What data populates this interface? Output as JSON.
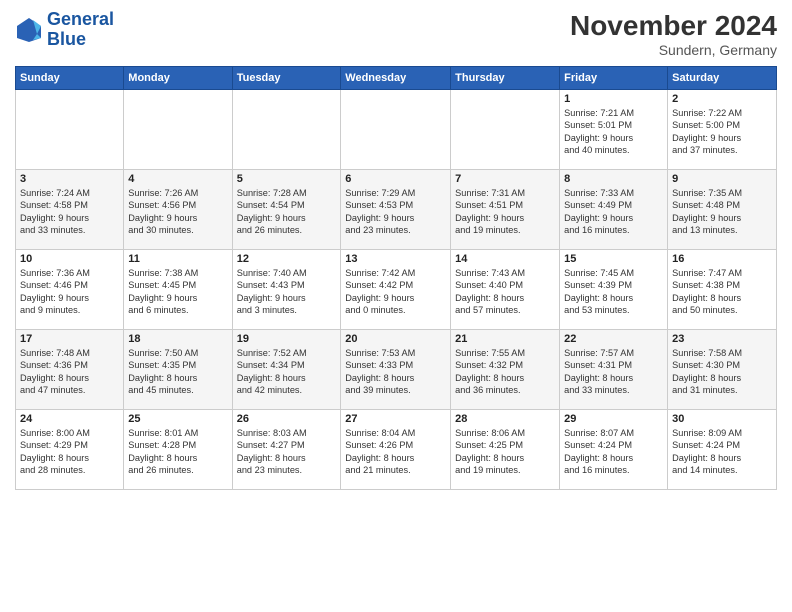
{
  "header": {
    "logo_line1": "General",
    "logo_line2": "Blue",
    "month_title": "November 2024",
    "subtitle": "Sundern, Germany"
  },
  "weekdays": [
    "Sunday",
    "Monday",
    "Tuesday",
    "Wednesday",
    "Thursday",
    "Friday",
    "Saturday"
  ],
  "weeks": [
    [
      {
        "day": "",
        "info": ""
      },
      {
        "day": "",
        "info": ""
      },
      {
        "day": "",
        "info": ""
      },
      {
        "day": "",
        "info": ""
      },
      {
        "day": "",
        "info": ""
      },
      {
        "day": "1",
        "info": "Sunrise: 7:21 AM\nSunset: 5:01 PM\nDaylight: 9 hours\nand 40 minutes."
      },
      {
        "day": "2",
        "info": "Sunrise: 7:22 AM\nSunset: 5:00 PM\nDaylight: 9 hours\nand 37 minutes."
      }
    ],
    [
      {
        "day": "3",
        "info": "Sunrise: 7:24 AM\nSunset: 4:58 PM\nDaylight: 9 hours\nand 33 minutes."
      },
      {
        "day": "4",
        "info": "Sunrise: 7:26 AM\nSunset: 4:56 PM\nDaylight: 9 hours\nand 30 minutes."
      },
      {
        "day": "5",
        "info": "Sunrise: 7:28 AM\nSunset: 4:54 PM\nDaylight: 9 hours\nand 26 minutes."
      },
      {
        "day": "6",
        "info": "Sunrise: 7:29 AM\nSunset: 4:53 PM\nDaylight: 9 hours\nand 23 minutes."
      },
      {
        "day": "7",
        "info": "Sunrise: 7:31 AM\nSunset: 4:51 PM\nDaylight: 9 hours\nand 19 minutes."
      },
      {
        "day": "8",
        "info": "Sunrise: 7:33 AM\nSunset: 4:49 PM\nDaylight: 9 hours\nand 16 minutes."
      },
      {
        "day": "9",
        "info": "Sunrise: 7:35 AM\nSunset: 4:48 PM\nDaylight: 9 hours\nand 13 minutes."
      }
    ],
    [
      {
        "day": "10",
        "info": "Sunrise: 7:36 AM\nSunset: 4:46 PM\nDaylight: 9 hours\nand 9 minutes."
      },
      {
        "day": "11",
        "info": "Sunrise: 7:38 AM\nSunset: 4:45 PM\nDaylight: 9 hours\nand 6 minutes."
      },
      {
        "day": "12",
        "info": "Sunrise: 7:40 AM\nSunset: 4:43 PM\nDaylight: 9 hours\nand 3 minutes."
      },
      {
        "day": "13",
        "info": "Sunrise: 7:42 AM\nSunset: 4:42 PM\nDaylight: 9 hours\nand 0 minutes."
      },
      {
        "day": "14",
        "info": "Sunrise: 7:43 AM\nSunset: 4:40 PM\nDaylight: 8 hours\nand 57 minutes."
      },
      {
        "day": "15",
        "info": "Sunrise: 7:45 AM\nSunset: 4:39 PM\nDaylight: 8 hours\nand 53 minutes."
      },
      {
        "day": "16",
        "info": "Sunrise: 7:47 AM\nSunset: 4:38 PM\nDaylight: 8 hours\nand 50 minutes."
      }
    ],
    [
      {
        "day": "17",
        "info": "Sunrise: 7:48 AM\nSunset: 4:36 PM\nDaylight: 8 hours\nand 47 minutes."
      },
      {
        "day": "18",
        "info": "Sunrise: 7:50 AM\nSunset: 4:35 PM\nDaylight: 8 hours\nand 45 minutes."
      },
      {
        "day": "19",
        "info": "Sunrise: 7:52 AM\nSunset: 4:34 PM\nDaylight: 8 hours\nand 42 minutes."
      },
      {
        "day": "20",
        "info": "Sunrise: 7:53 AM\nSunset: 4:33 PM\nDaylight: 8 hours\nand 39 minutes."
      },
      {
        "day": "21",
        "info": "Sunrise: 7:55 AM\nSunset: 4:32 PM\nDaylight: 8 hours\nand 36 minutes."
      },
      {
        "day": "22",
        "info": "Sunrise: 7:57 AM\nSunset: 4:31 PM\nDaylight: 8 hours\nand 33 minutes."
      },
      {
        "day": "23",
        "info": "Sunrise: 7:58 AM\nSunset: 4:30 PM\nDaylight: 8 hours\nand 31 minutes."
      }
    ],
    [
      {
        "day": "24",
        "info": "Sunrise: 8:00 AM\nSunset: 4:29 PM\nDaylight: 8 hours\nand 28 minutes."
      },
      {
        "day": "25",
        "info": "Sunrise: 8:01 AM\nSunset: 4:28 PM\nDaylight: 8 hours\nand 26 minutes."
      },
      {
        "day": "26",
        "info": "Sunrise: 8:03 AM\nSunset: 4:27 PM\nDaylight: 8 hours\nand 23 minutes."
      },
      {
        "day": "27",
        "info": "Sunrise: 8:04 AM\nSunset: 4:26 PM\nDaylight: 8 hours\nand 21 minutes."
      },
      {
        "day": "28",
        "info": "Sunrise: 8:06 AM\nSunset: 4:25 PM\nDaylight: 8 hours\nand 19 minutes."
      },
      {
        "day": "29",
        "info": "Sunrise: 8:07 AM\nSunset: 4:24 PM\nDaylight: 8 hours\nand 16 minutes."
      },
      {
        "day": "30",
        "info": "Sunrise: 8:09 AM\nSunset: 4:24 PM\nDaylight: 8 hours\nand 14 minutes."
      }
    ]
  ]
}
